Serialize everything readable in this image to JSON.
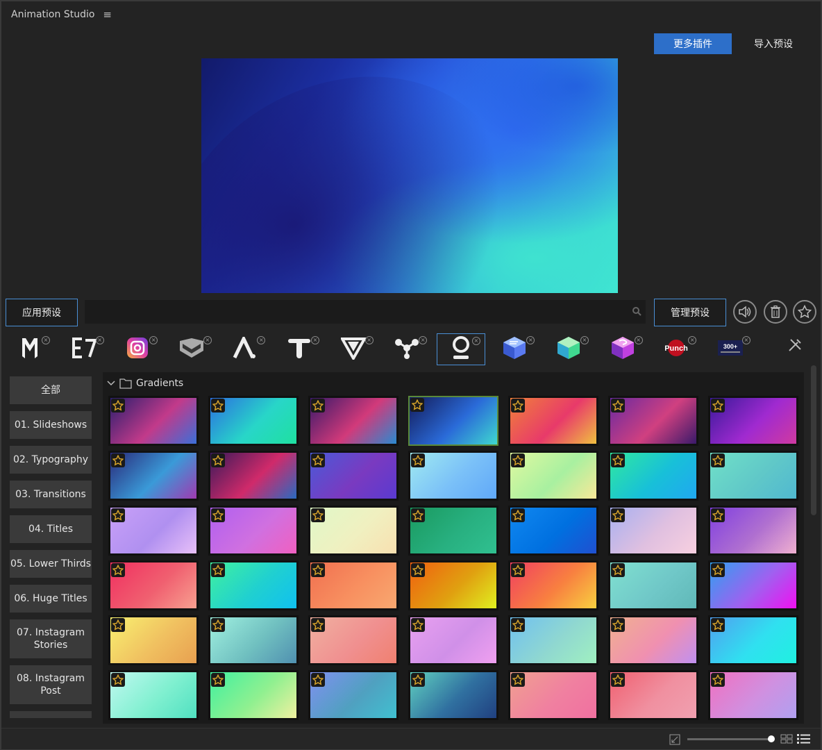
{
  "window": {
    "title": "Animation Studio"
  },
  "header": {
    "more_plugins": "更多插件",
    "import_preset": "导入预设"
  },
  "toolbar": {
    "apply_preset": "应用预设",
    "manage_preset": "管理预设",
    "search_placeholder": ""
  },
  "plugins": [
    {
      "icon": "m-logo-icon"
    },
    {
      "icon": "e7-logo-icon"
    },
    {
      "icon": "instagram-icon"
    },
    {
      "icon": "badge-chevron-icon"
    },
    {
      "icon": "a-logo-icon"
    },
    {
      "icon": "t-logo-icon"
    },
    {
      "icon": "v-triangle-icon"
    },
    {
      "icon": "nodes-icon"
    },
    {
      "icon": "o-logo-icon",
      "selected": true
    },
    {
      "icon": "cube-blue-icon"
    },
    {
      "icon": "cube-green-icon"
    },
    {
      "icon": "cube-purple-icon"
    },
    {
      "icon": "punch-logo-icon",
      "label": "Punch"
    },
    {
      "icon": "transitions-logo-icon",
      "label": "300+"
    }
  ],
  "categories": [
    "全部",
    "01. Slideshows",
    "02. Typography",
    "03. Transitions",
    "04. Titles",
    "05. Lower Thirds",
    "06. Huge Titles",
    "07. Instagram Stories",
    "08. Instagram Post"
  ],
  "folder": {
    "name": "Gradients"
  },
  "colors": {
    "accent": "#2d6fc9",
    "star": "#d9a52b"
  },
  "thumbnails": [
    [
      "#2a1f6e",
      "#c23a8a",
      "#3b6fd8"
    ],
    [
      "#2b6fe0",
      "#28d6c8",
      "#1fe0a0"
    ],
    [
      "#3a1a6a",
      "#d23a7a",
      "#2a8ad0"
    ],
    [
      "#141c5a",
      "#2a6ad8",
      "#3fd8d0"
    ],
    [
      "#f0803a",
      "#e83a6a",
      "#f0c040"
    ],
    [
      "#6a2aa0",
      "#d04080",
      "#3a1a6a"
    ],
    [
      "#3a1a9a",
      "#a02ad0",
      "#d03aa0"
    ],
    [
      "#2a2a7a",
      "#3a9ad8",
      "#a03ab0"
    ],
    [
      "#3a1a5a",
      "#d02a6a",
      "#2a6ac0"
    ],
    [
      "#4a5ad8",
      "#7a3ac0",
      "#5a3ad0"
    ],
    [
      "#a0eaf0",
      "#7ac0f8",
      "#60a8f8"
    ],
    [
      "#e0f8a0",
      "#a8f0a0",
      "#f8e898"
    ],
    [
      "#30e8a0",
      "#18c0d8",
      "#20a8f0"
    ],
    [
      "#70e0c8",
      "#60c8c8",
      "#50b8d0"
    ],
    [
      "#c8a0f8",
      "#b090f0",
      "#e8c0f8"
    ],
    [
      "#b060f0",
      "#d070e0",
      "#f060c0"
    ],
    [
      "#e0f8c8",
      "#f0f0c0",
      "#f8e0b0"
    ],
    [
      "#1a9a60",
      "#28b080",
      "#30c090"
    ],
    [
      "#1088f0",
      "#0070e0",
      "#2050d0"
    ],
    [
      "#a8b0f0",
      "#e0c0e0",
      "#f8d0e0"
    ],
    [
      "#8040e0",
      "#b070d0",
      "#f0b0d0"
    ],
    [
      "#f03060",
      "#f06070",
      "#f8a090"
    ],
    [
      "#40f0a0",
      "#20d0d0",
      "#10c0f0"
    ],
    [
      "#f07050",
      "#f89060",
      "#f8a870"
    ],
    [
      "#f06010",
      "#e0a010",
      "#e0f020"
    ],
    [
      "#f04060",
      "#f88040",
      "#f8d040"
    ],
    [
      "#80e0d0",
      "#70c8c8",
      "#60b8b8"
    ],
    [
      "#30a0f0",
      "#a060f0",
      "#f010f0"
    ],
    [
      "#f8f070",
      "#f0c060",
      "#e8a050"
    ],
    [
      "#a0f0e0",
      "#70c0c0",
      "#5090b0"
    ],
    [
      "#f0b0a0",
      "#f09090",
      "#f08070"
    ],
    [
      "#e8a0f0",
      "#d090e8",
      "#f0a0f0"
    ],
    [
      "#70c0f0",
      "#90d8d0",
      "#a0f0c0"
    ],
    [
      "#f0b090",
      "#f090b0",
      "#c090f0"
    ],
    [
      "#50a0f0",
      "#30e0f0",
      "#20f0e0"
    ],
    [
      "#c0f8f0",
      "#80f0d0",
      "#50e0c0"
    ],
    [
      "#40f0a0",
      "#90f090",
      "#f0f0a0"
    ],
    [
      "#8090f0",
      "#50a0c0",
      "#40c0d0"
    ],
    [
      "#60d0c0",
      "#3070a0",
      "#204080"
    ],
    [
      "#f0a090",
      "#f080a0",
      "#f070a0"
    ],
    [
      "#f06070",
      "#f090a0",
      "#f0a0b0"
    ],
    [
      "#f070c0",
      "#d090e0",
      "#b0a0f0"
    ]
  ]
}
